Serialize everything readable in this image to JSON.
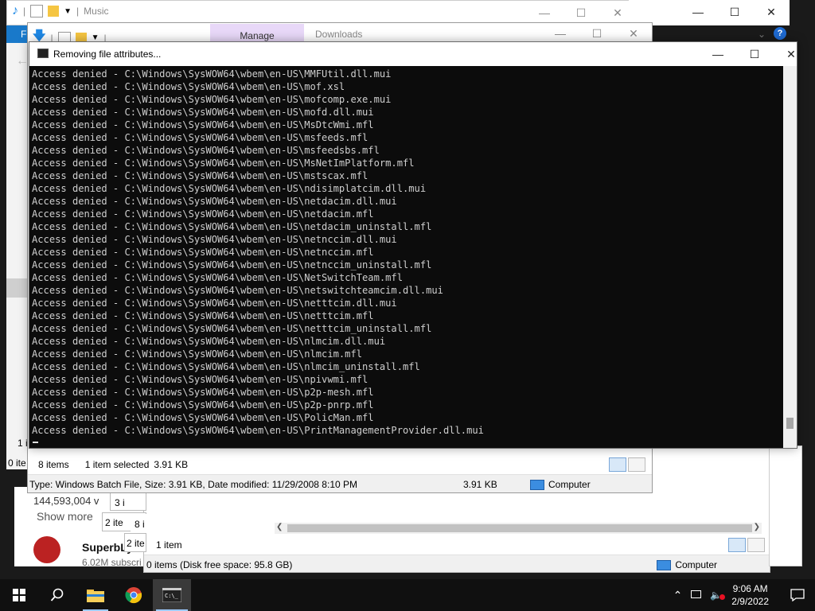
{
  "music_window": {
    "title": "Music"
  },
  "downloads_window": {
    "tab_manage": "Manage",
    "title": "Downloads",
    "status_items": "8 items",
    "status_selected": "1 item selected",
    "status_size": "3.91 KB",
    "details": "Type: Windows Batch File, Size: 3.91 KB, Date modified: 11/29/2008 8:10 PM",
    "details_size": "3.91 KB",
    "details_location": "Computer"
  },
  "back_window": {
    "status_items": "1 item",
    "details": "0 items (Disk free space: 95.8 GB)",
    "details_location": "Computer"
  },
  "left_fragments": {
    "f1": "F",
    "i1": "1 i",
    "i2": "0 ite",
    "views": "144,593,004 v",
    "show_more": "Show more",
    "channel": "SuperbLy...",
    "subs": "6.02M subscri",
    "n3": "3 i",
    "n2": "2 ite",
    "n8": "8 i",
    "n2b": "2 ite"
  },
  "console": {
    "title": "Removing file attributes...",
    "lines": [
      "Access denied - C:\\Windows\\SysWOW64\\wbem\\en-US\\MMFUtil.dll.mui",
      "Access denied - C:\\Windows\\SysWOW64\\wbem\\en-US\\mof.xsl",
      "Access denied - C:\\Windows\\SysWOW64\\wbem\\en-US\\mofcomp.exe.mui",
      "Access denied - C:\\Windows\\SysWOW64\\wbem\\en-US\\mofd.dll.mui",
      "Access denied - C:\\Windows\\SysWOW64\\wbem\\en-US\\MsDtcWmi.mfl",
      "Access denied - C:\\Windows\\SysWOW64\\wbem\\en-US\\msfeeds.mfl",
      "Access denied - C:\\Windows\\SysWOW64\\wbem\\en-US\\msfeedsbs.mfl",
      "Access denied - C:\\Windows\\SysWOW64\\wbem\\en-US\\MsNetImPlatform.mfl",
      "Access denied - C:\\Windows\\SysWOW64\\wbem\\en-US\\mstscax.mfl",
      "Access denied - C:\\Windows\\SysWOW64\\wbem\\en-US\\ndisimplatcim.dll.mui",
      "Access denied - C:\\Windows\\SysWOW64\\wbem\\en-US\\netdacim.dll.mui",
      "Access denied - C:\\Windows\\SysWOW64\\wbem\\en-US\\netdacim.mfl",
      "Access denied - C:\\Windows\\SysWOW64\\wbem\\en-US\\netdacim_uninstall.mfl",
      "Access denied - C:\\Windows\\SysWOW64\\wbem\\en-US\\netnccim.dll.mui",
      "Access denied - C:\\Windows\\SysWOW64\\wbem\\en-US\\netnccim.mfl",
      "Access denied - C:\\Windows\\SysWOW64\\wbem\\en-US\\netnccim_uninstall.mfl",
      "Access denied - C:\\Windows\\SysWOW64\\wbem\\en-US\\NetSwitchTeam.mfl",
      "Access denied - C:\\Windows\\SysWOW64\\wbem\\en-US\\netswitchteamcim.dll.mui",
      "Access denied - C:\\Windows\\SysWOW64\\wbem\\en-US\\netttcim.dll.mui",
      "Access denied - C:\\Windows\\SysWOW64\\wbem\\en-US\\netttcim.mfl",
      "Access denied - C:\\Windows\\SysWOW64\\wbem\\en-US\\netttcim_uninstall.mfl",
      "Access denied - C:\\Windows\\SysWOW64\\wbem\\en-US\\nlmcim.dll.mui",
      "Access denied - C:\\Windows\\SysWOW64\\wbem\\en-US\\nlmcim.mfl",
      "Access denied - C:\\Windows\\SysWOW64\\wbem\\en-US\\nlmcim_uninstall.mfl",
      "Access denied - C:\\Windows\\SysWOW64\\wbem\\en-US\\npivwmi.mfl",
      "Access denied - C:\\Windows\\SysWOW64\\wbem\\en-US\\p2p-mesh.mfl",
      "Access denied - C:\\Windows\\SysWOW64\\wbem\\en-US\\p2p-pnrp.mfl",
      "Access denied - C:\\Windows\\SysWOW64\\wbem\\en-US\\PolicMan.mfl",
      "Access denied - C:\\Windows\\SysWOW64\\wbem\\en-US\\PrintManagementProvider.dll.mui"
    ]
  },
  "taskbar": {
    "time": "9:06 AM",
    "date": "2/9/2022"
  },
  "icons": {
    "start": "windows-logo",
    "search": "search-icon",
    "explorer": "folder-icon",
    "chrome": "chrome-icon",
    "cmd": "cmd-icon"
  },
  "colors": {
    "accent": "#0078d7",
    "manage_tab": "#e8d8f8",
    "console_bg": "#0c0c0c",
    "console_text": "#cfcfcf"
  }
}
